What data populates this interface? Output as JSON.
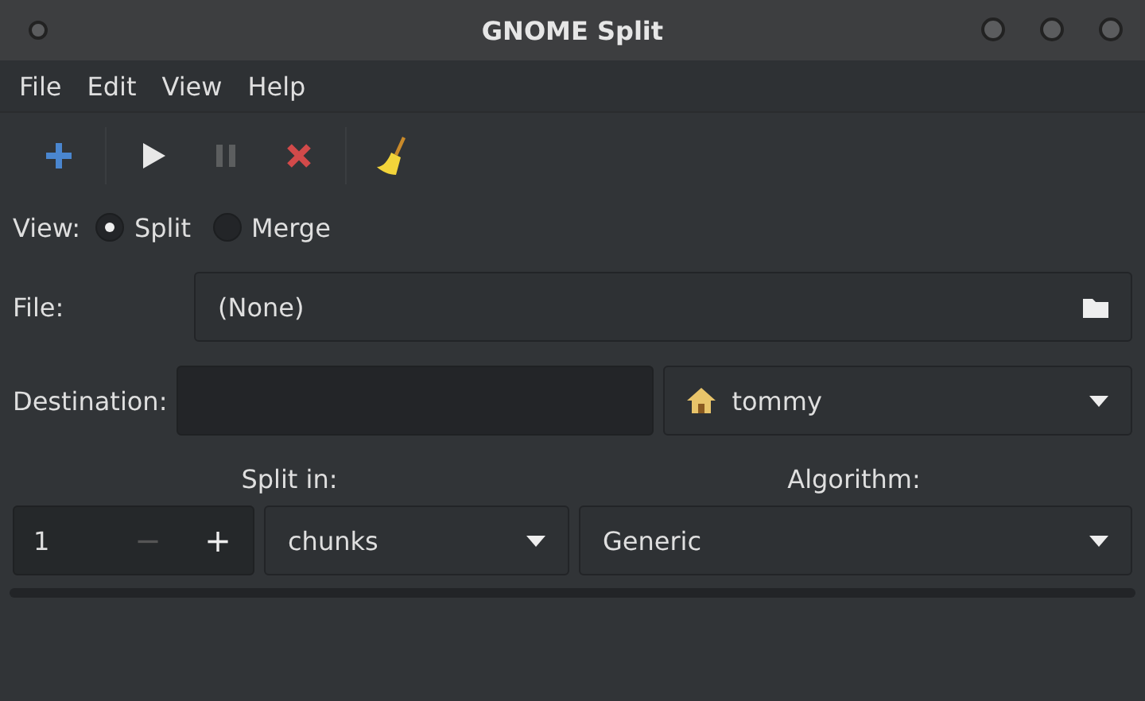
{
  "window": {
    "title": "GNOME Split"
  },
  "menu": [
    "File",
    "Edit",
    "View",
    "Help"
  ],
  "toolbar": [
    {
      "kind": "add",
      "disabled": false
    },
    {
      "kind": "separator"
    },
    {
      "kind": "start",
      "disabled": false
    },
    {
      "kind": "pause",
      "disabled": true
    },
    {
      "kind": "cancel",
      "disabled": false
    },
    {
      "kind": "separator"
    },
    {
      "kind": "clean",
      "disabled": false
    }
  ],
  "view": {
    "label": "View:",
    "options": [
      {
        "label": "Split",
        "selected": true
      },
      {
        "label": "Merge",
        "selected": false
      }
    ]
  },
  "file": {
    "label": "File:",
    "value": "(None)"
  },
  "destination": {
    "label": "Destination:",
    "folder": "tommy"
  },
  "split_in": {
    "label": "Split in:",
    "value": "1",
    "minus_disabled": true,
    "plus_disabled": false,
    "minus": "−",
    "plus": "+",
    "unit": "chunks"
  },
  "algorithm": {
    "label": "Algorithm:",
    "value": "Generic"
  }
}
